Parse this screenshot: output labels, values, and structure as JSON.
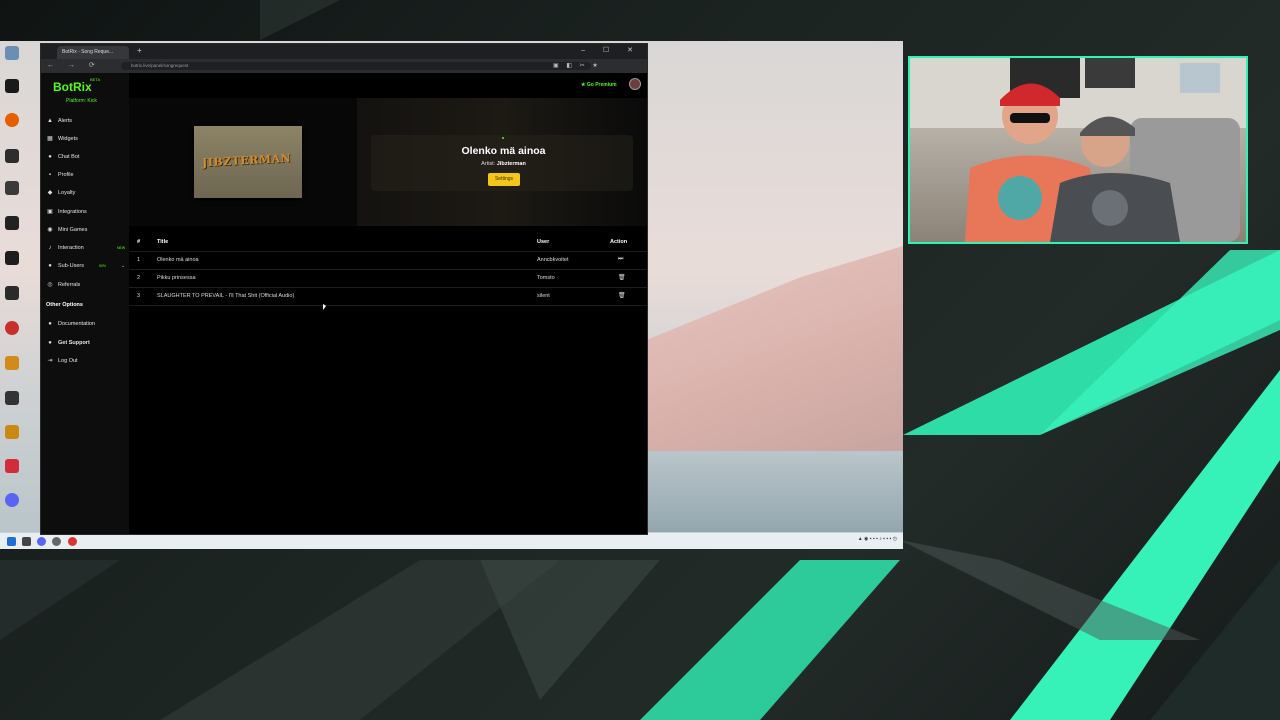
{
  "browser": {
    "tab_title": "BotRix - Song Reque...",
    "new_tab": "+",
    "window_controls": "– ☐ ✕",
    "nav": "← → ⟳",
    "url": "botrix.live/panel/songrequest"
  },
  "app": {
    "logo": "BotRix",
    "logo_badge": "BETA",
    "platform_label": "Platform:",
    "platform_value": "Kick",
    "premium_label": "Go Premium",
    "nav": [
      {
        "label": "Alerts",
        "icon": "alert-icon"
      },
      {
        "label": "Widgets",
        "icon": "widgets-icon"
      },
      {
        "label": "Chat Bot",
        "icon": "chat-icon"
      },
      {
        "label": "Profile",
        "icon": "profile-icon"
      },
      {
        "label": "Loyalty",
        "icon": "loyalty-icon"
      },
      {
        "label": "Integrations",
        "icon": "integrations-icon"
      },
      {
        "label": "Mini Games",
        "icon": "games-icon"
      },
      {
        "label": "Interaction",
        "icon": "music-icon",
        "badge": "NEW"
      },
      {
        "label": "Sub-Users",
        "icon": "users-icon",
        "badge": "50%"
      },
      {
        "label": "Referrals",
        "icon": "referrals-icon"
      }
    ],
    "other_options_title": "Other Options",
    "other_nav": [
      {
        "label": "Documentation"
      },
      {
        "label": "Get Support"
      },
      {
        "label": "Log Out"
      }
    ],
    "now_playing": {
      "cover_text": "JIBZTERMAN",
      "title": "Olenko mä ainoa",
      "artist_label": "Artist:",
      "artist": "Jibzterman",
      "settings_button": "Settings"
    },
    "table": {
      "headers": [
        "#",
        "Title",
        "User",
        "Action"
      ],
      "rows": [
        {
          "num": "1",
          "title": "Olenko mä ainoa",
          "user": "Anncbkvoitet",
          "action": "⏭"
        },
        {
          "num": "2",
          "title": "Pikku prinsessa",
          "user": "Tomsto",
          "action": "🗑"
        },
        {
          "num": "3",
          "title": "SLAUGHTER TO PREVAIL - I'll That Shit (Official Audio)",
          "user": "silent",
          "action": "🗑"
        }
      ]
    }
  },
  "colors": {
    "accent": "#53fc18",
    "settings_button": "#f5c518",
    "cam_border": "#2ff2b4"
  }
}
